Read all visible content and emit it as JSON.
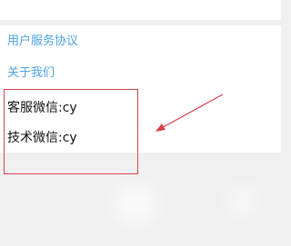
{
  "menu": {
    "user_agreement": "用户服务协议",
    "about_us": "关于我们"
  },
  "contacts": {
    "service_wechat": "客服微信:cy",
    "tech_wechat": "技术微信:cy"
  },
  "colors": {
    "link": "#4aa3e6",
    "annotation": "#d9414a",
    "background": "#f0f0f0"
  }
}
